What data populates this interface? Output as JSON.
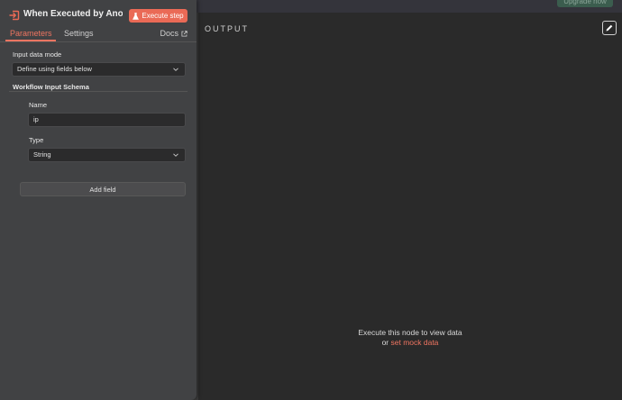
{
  "topbar": {
    "upgrade_label": "Upgrade now"
  },
  "node": {
    "title": "When Executed by Ano...",
    "execute_label": "Execute step"
  },
  "tabs": [
    {
      "label": "Parameters",
      "active": true
    },
    {
      "label": "Settings",
      "active": false
    }
  ],
  "docs_label": "Docs",
  "params": {
    "input_mode_label": "Input data mode",
    "input_mode_value": "Define using fields below",
    "schema_label": "Workflow Input Schema",
    "name_label": "Name",
    "name_value": "ip",
    "type_label": "Type",
    "type_value": "String",
    "add_field_label": "Add field"
  },
  "output": {
    "title": "OUTPUT",
    "empty_line1": "Execute this node to view data",
    "empty_prefix": "or",
    "mock_link": "set mock data"
  },
  "colors": {
    "accent": "#ea6a56",
    "panel_bg": "#414244",
    "canvas_bg": "#2a2a2a"
  }
}
